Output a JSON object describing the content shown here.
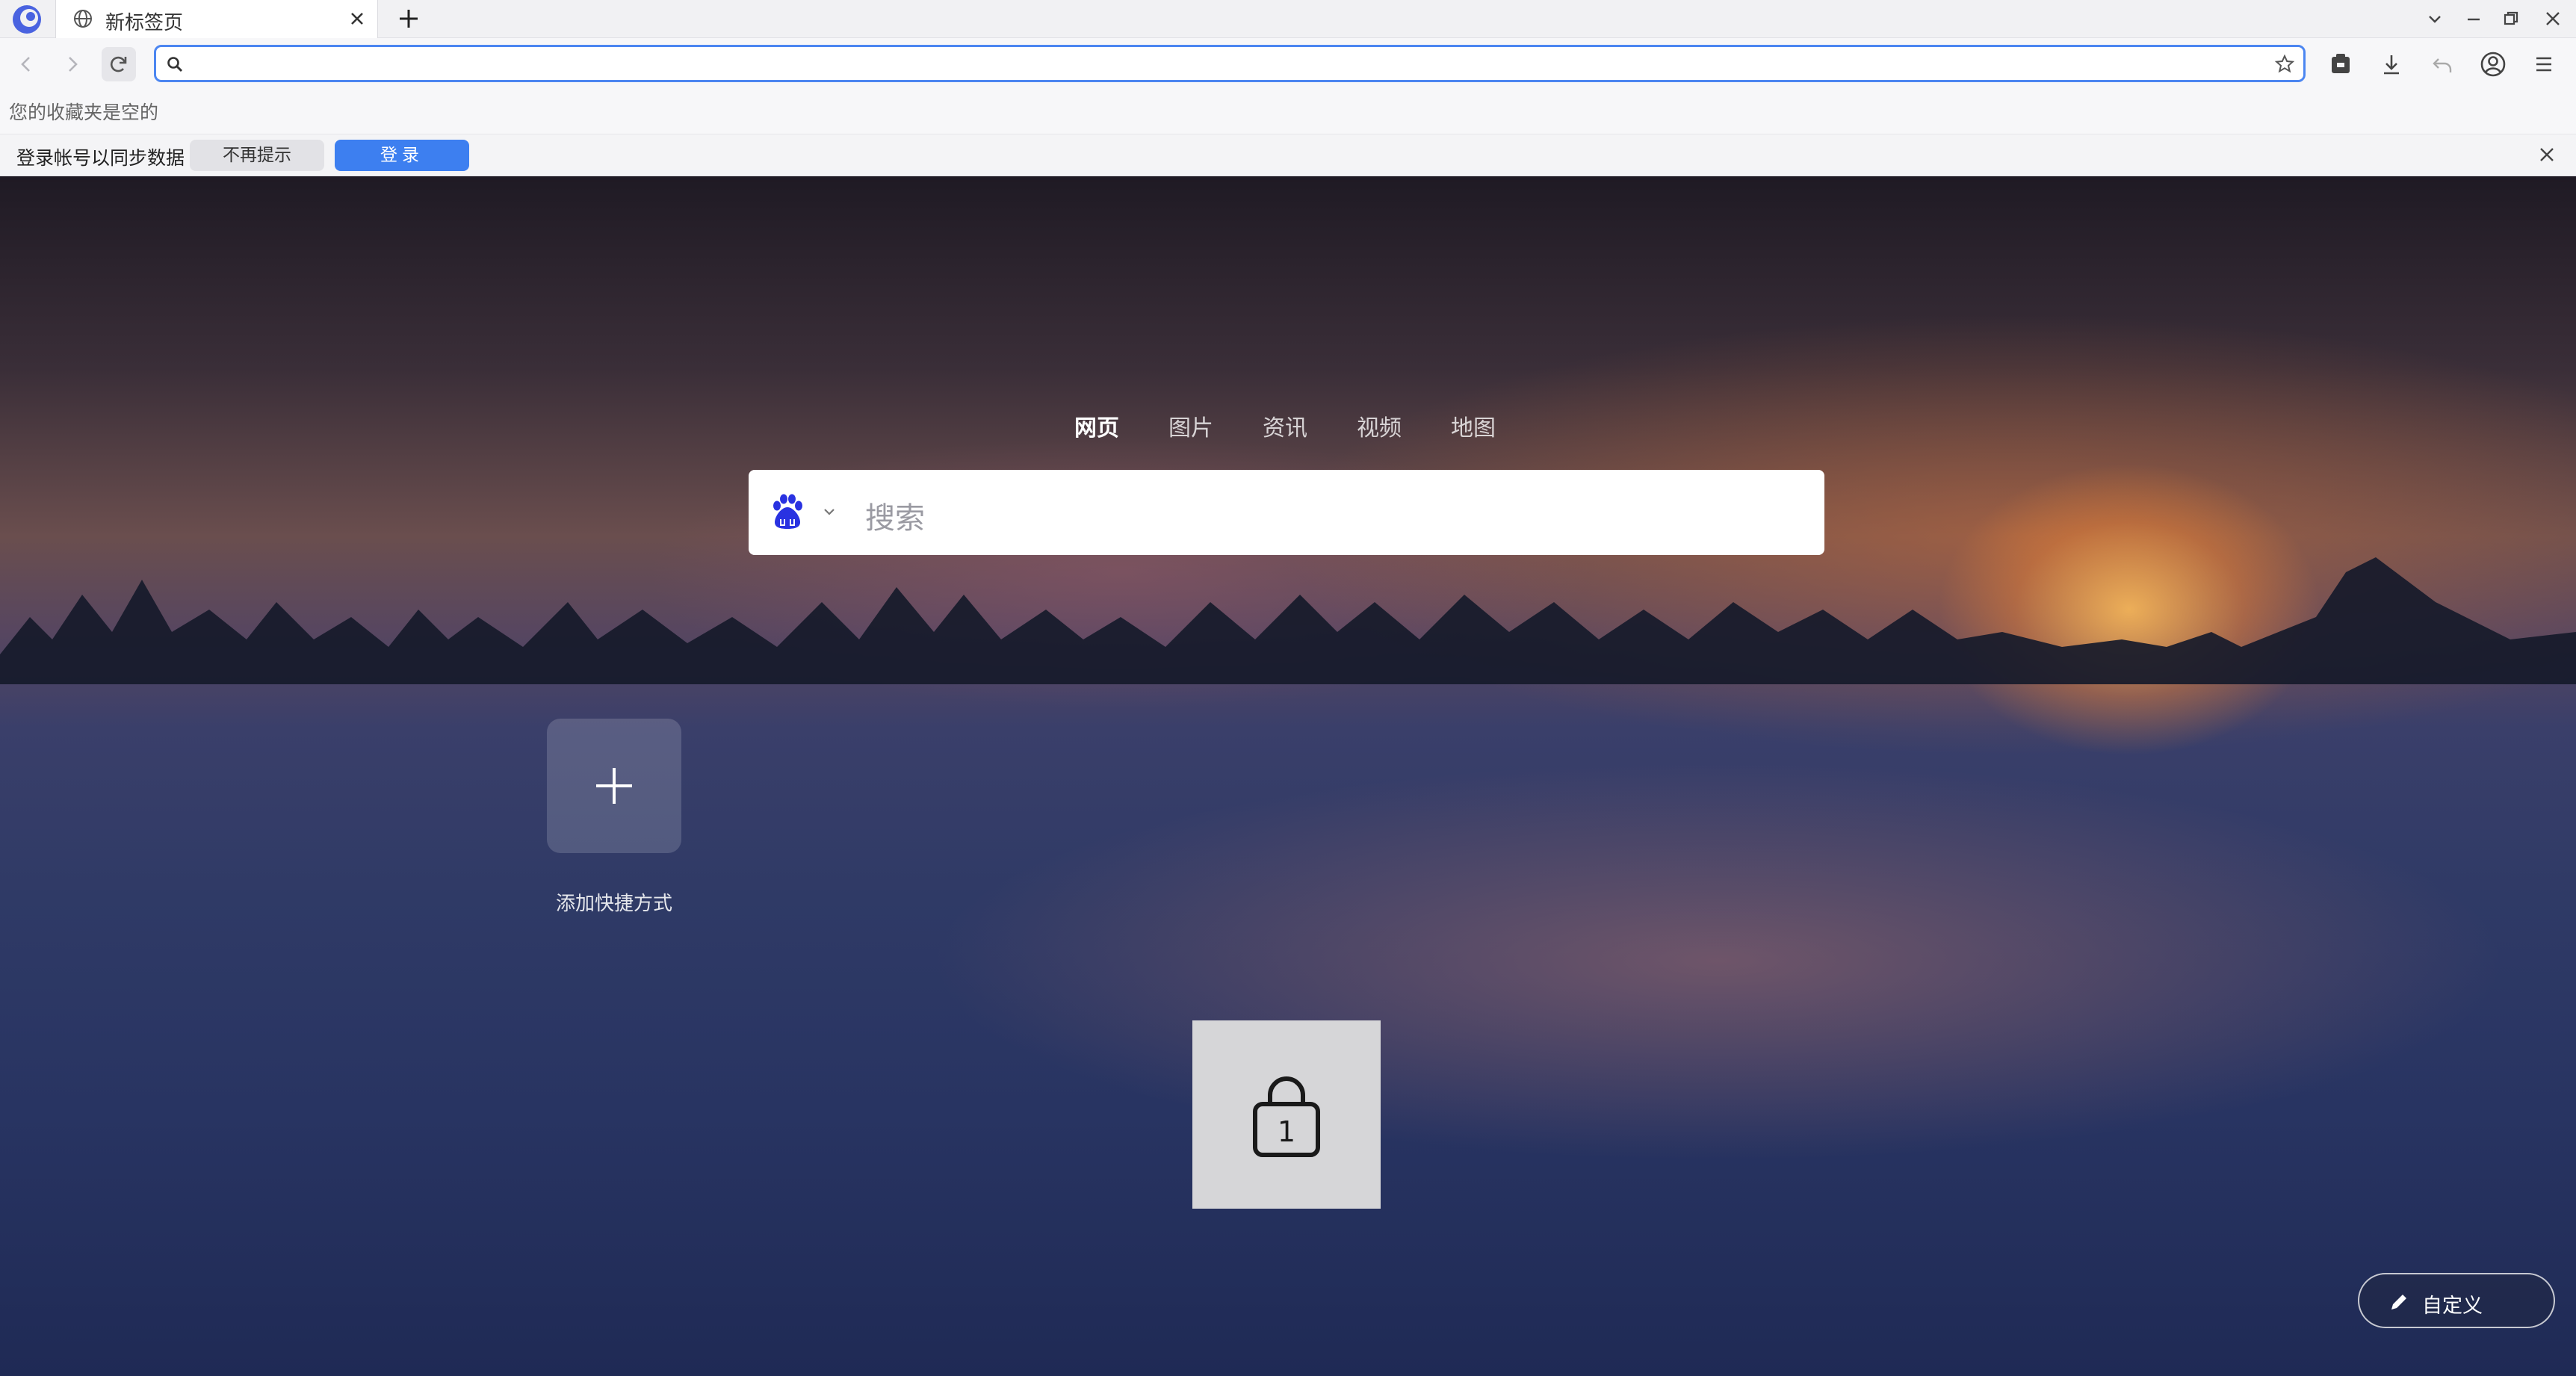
{
  "tab": {
    "title": "新标签页"
  },
  "address_bar": {
    "value": "",
    "placeholder": ""
  },
  "bookmarks": {
    "empty_text": "您的收藏夹是空的"
  },
  "sync_bar": {
    "message": "登录帐号以同步数据",
    "dismiss_label": "不再提示",
    "login_label": "登录"
  },
  "search": {
    "tabs": [
      "网页",
      "图片",
      "资讯",
      "视频",
      "地图"
    ],
    "active_tab": "网页",
    "engine_icon": "baidu-paw-icon",
    "placeholder": "搜索"
  },
  "shortcuts": {
    "add_label": "添加快捷方式"
  },
  "lock_card": {
    "number": "1"
  },
  "customize": {
    "label": "自定义"
  },
  "colors": {
    "accent": "#4c86f1",
    "login_button": "#3d7ff0",
    "baidu_blue": "#2932e1"
  },
  "icons": [
    "app-logo-icon",
    "globe-icon",
    "close-icon",
    "plus-icon",
    "chevron-down-icon",
    "minimize-icon",
    "restore-icon",
    "back-icon",
    "forward-icon",
    "reload-icon",
    "search-icon",
    "star-icon",
    "extension-icon",
    "download-icon",
    "undo-icon",
    "account-icon",
    "menu-icon",
    "lock-icon",
    "pencil-icon"
  ]
}
